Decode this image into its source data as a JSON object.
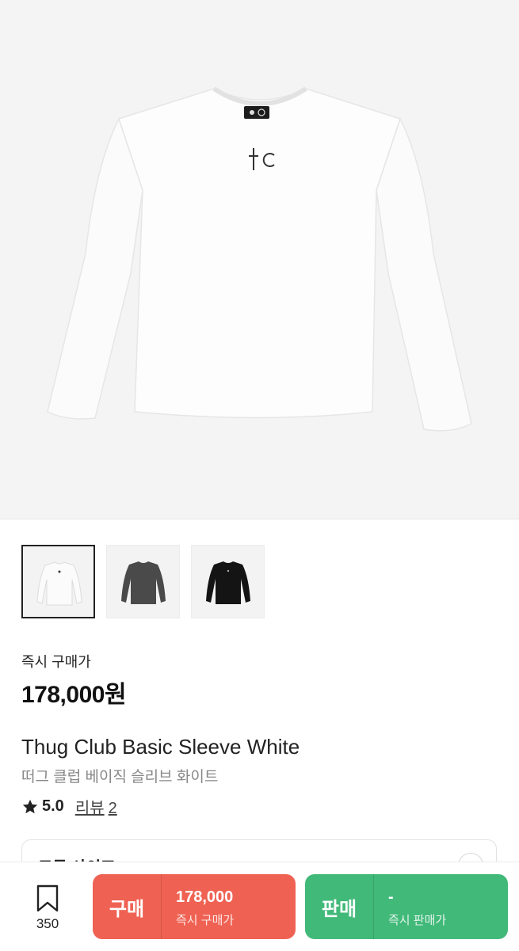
{
  "product": {
    "images": [
      {
        "name": "white-tee",
        "color": "#ffffff"
      },
      {
        "name": "gray-tee",
        "color": "#4a4a4a"
      },
      {
        "name": "black-tee",
        "color": "#141414"
      }
    ],
    "price_label": "즉시 구매가",
    "price": "178,000원",
    "title": "Thug Club Basic Sleeve White",
    "subtitle": "떠그 클럽 베이직 슬리브 화이트",
    "rating": "5.0",
    "review_label": "리뷰",
    "review_count": "2",
    "size_label": "모든 사이즈"
  },
  "bottom_bar": {
    "wish_count": "350",
    "buy": {
      "label": "구매",
      "amount": "178,000",
      "caption": "즉시 구매가",
      "color": "#ef6253"
    },
    "sell": {
      "label": "판매",
      "amount": "-",
      "caption": "즉시 판매가",
      "color": "#41b979"
    }
  }
}
